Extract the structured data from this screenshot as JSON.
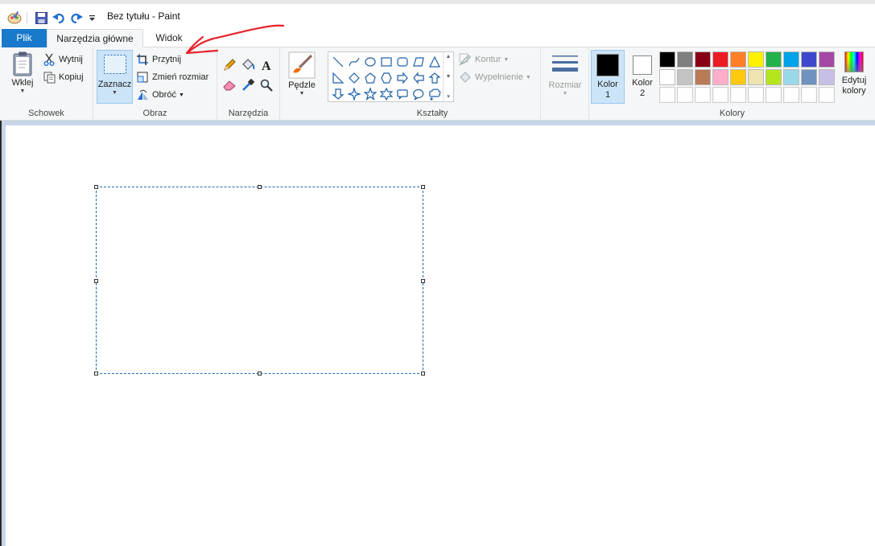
{
  "window": {
    "title": "Bez tytułu - Paint"
  },
  "tabs": {
    "file": "Plik",
    "home": "Narzędzia główne",
    "view": "Widok"
  },
  "groups": {
    "clipboard": {
      "label": "Schowek",
      "paste": "Wklej",
      "cut": "Wytnij",
      "copy": "Kopiuj"
    },
    "image": {
      "label": "Obraz",
      "select": "Zaznacz",
      "crop": "Przytnij",
      "resize": "Zmień rozmiar",
      "rotate": "Obróć"
    },
    "tools": {
      "label": "Narzędzia"
    },
    "brushes": {
      "label": "Pędzle"
    },
    "shapes": {
      "label": "Kształty",
      "outline": "Kontur",
      "fill": "Wypełnienie"
    },
    "size": {
      "label": "Rozmiar"
    },
    "colors": {
      "label": "Kolory",
      "color1_line1": "Kolor",
      "color1_line2": "1",
      "color2_line1": "Kolor",
      "color2_line2": "2",
      "edit_line1": "Edytuj",
      "edit_line2": "kolory",
      "color1_value": "#000000",
      "color2_value": "#ffffff",
      "palette": [
        "#000000",
        "#7f7f7f",
        "#880015",
        "#ed1c24",
        "#ff7f27",
        "#fff200",
        "#22b14c",
        "#00a2e8",
        "#3f48cc",
        "#a349a4",
        "#ffffff",
        "#c3c3c3",
        "#b97a57",
        "#ffaec9",
        "#ffc90e",
        "#efe4b0",
        "#b5e61d",
        "#99d9ea",
        "#7092be",
        "#c8bfe7"
      ]
    }
  },
  "shape_icons": [
    "line-shape-icon",
    "curve-shape-icon",
    "oval-shape-icon",
    "rectangle-shape-icon",
    "rounded-rectangle-shape-icon",
    "polygon-shape-icon",
    "triangle-shape-icon",
    "right-triangle-shape-icon",
    "diamond-shape-icon",
    "pentagon-shape-icon",
    "hexagon-shape-icon",
    "right-arrow-shape-icon",
    "left-arrow-shape-icon",
    "up-arrow-shape-icon",
    "down-arrow-shape-icon",
    "four-point-star-shape-icon",
    "five-point-star-shape-icon",
    "six-point-star-shape-icon",
    "rounded-callout-shape-icon",
    "oval-callout-shape-icon",
    "cloud-callout-shape-icon"
  ],
  "accent": "#1979ca",
  "annotation_color": "#e8232a"
}
